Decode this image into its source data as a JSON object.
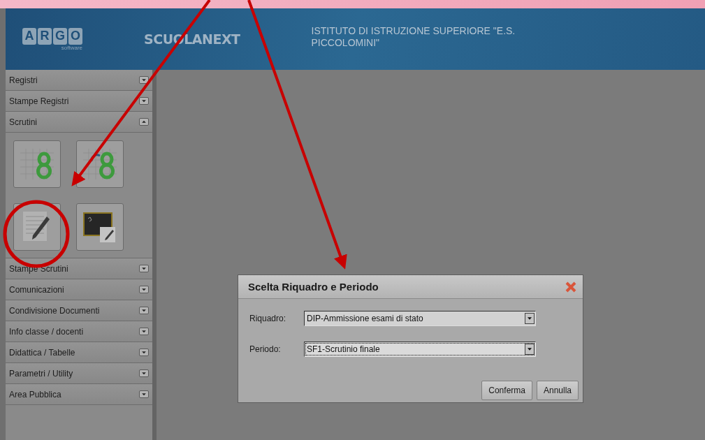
{
  "header": {
    "logo_letters": [
      "A",
      "R",
      "G",
      "O"
    ],
    "logo_subtitle": "software",
    "product": "SCUOLANEXT",
    "school": "ISTITUTO DI ISTRUZIONE SUPERIORE \"E.S.\nPICCOLOMINI\""
  },
  "sidebar": {
    "sections": [
      {
        "label": "Registri",
        "expanded": false
      },
      {
        "label": "Stampe Registri",
        "expanded": false
      },
      {
        "label": "Scrutini",
        "expanded": true,
        "tiles": [
          {
            "kind": "grid-eight"
          },
          {
            "kind": "grid-eight-sync"
          },
          {
            "kind": "pencil-document"
          },
          {
            "kind": "blackboard"
          }
        ]
      },
      {
        "label": "Stampe Scrutini",
        "expanded": false
      },
      {
        "label": "Comunicazioni",
        "expanded": false
      },
      {
        "label": "Condivisione Documenti",
        "expanded": false
      },
      {
        "label": "Info classe / docenti",
        "expanded": false
      },
      {
        "label": "Didattica / Tabelle",
        "expanded": false
      },
      {
        "label": "Parametri / Utility",
        "expanded": false
      },
      {
        "label": "Area Pubblica",
        "expanded": false
      }
    ]
  },
  "dialog": {
    "title": "Scelta Riquadro e Periodo",
    "fields": [
      {
        "label": "Riquadro:",
        "value": "DIP-Ammissione esami di stato",
        "focused": false
      },
      {
        "label": "Periodo:",
        "value": "SF1-Scrutinio finale",
        "focused": true
      }
    ],
    "buttons": [
      "Conferma",
      "Annulla"
    ]
  }
}
